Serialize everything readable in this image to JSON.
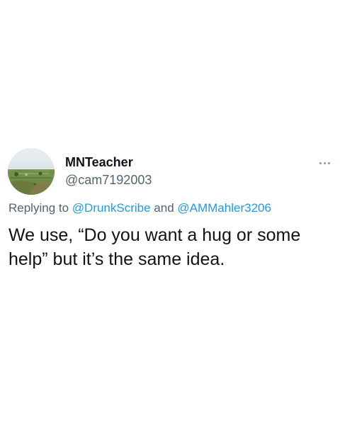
{
  "author": {
    "display_name": "MNTeacher",
    "handle": "@cam7192003"
  },
  "avatar": {
    "description_icon": "landscape-avatar-icon"
  },
  "reply": {
    "prefix": "Replying to ",
    "mention_1": "@DrunkScribe",
    "connector": " and ",
    "mention_2": "@AMMahler3206"
  },
  "tweet": {
    "text": "We use, “Do you want a hug or some help” but it’s the same idea."
  },
  "colors": {
    "text_primary": "#0f1419",
    "text_secondary": "#536471",
    "accent": "#1d9bf0",
    "background": "#ffffff"
  },
  "icons": {
    "more": "more-options-icon"
  }
}
